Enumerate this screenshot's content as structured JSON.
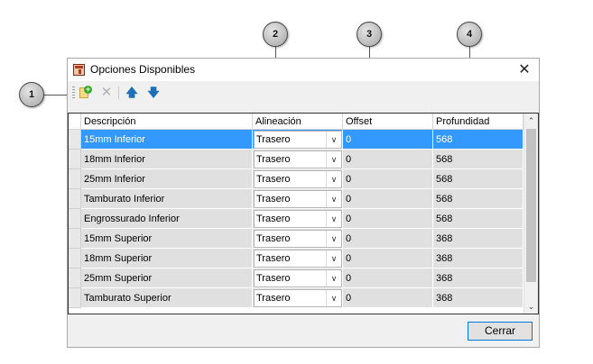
{
  "window": {
    "title": "Opciones Disponibles",
    "close_glyph": "✕"
  },
  "callouts": [
    "1",
    "2",
    "3",
    "4"
  ],
  "toolbar": {
    "icons": [
      "add-icon",
      "delete-icon",
      "move-up-icon",
      "move-down-icon"
    ],
    "up_glyph": "🡅",
    "down_glyph": "🡇",
    "delete_glyph": "✕",
    "add_glyph": "+"
  },
  "grid": {
    "columns": [
      "Descripción",
      "Alineación",
      "Offset",
      "Profundidad"
    ],
    "rows": [
      {
        "descripcion": "15mm Inferior",
        "alineacion": "Trasero",
        "offset": "0",
        "profundidad": "568"
      },
      {
        "descripcion": "18mm Inferior",
        "alineacion": "Trasero",
        "offset": "0",
        "profundidad": "568"
      },
      {
        "descripcion": "25mm Inferior",
        "alineacion": "Trasero",
        "offset": "0",
        "profundidad": "568"
      },
      {
        "descripcion": "Tamburato Inferior",
        "alineacion": "Trasero",
        "offset": "0",
        "profundidad": "568"
      },
      {
        "descripcion": "Engrossurado Inferior",
        "alineacion": "Trasero",
        "offset": "0",
        "profundidad": "568"
      },
      {
        "descripcion": "15mm Superior",
        "alineacion": "Trasero",
        "offset": "0",
        "profundidad": "368"
      },
      {
        "descripcion": "18mm Superior",
        "alineacion": "Trasero",
        "offset": "0",
        "profundidad": "368"
      },
      {
        "descripcion": "25mm Superior",
        "alineacion": "Trasero",
        "offset": "0",
        "profundidad": "368"
      },
      {
        "descripcion": "Tamburato Superior",
        "alineacion": "Trasero",
        "offset": "0",
        "profundidad": "368"
      }
    ],
    "selected_row": 0,
    "scroll_up": "⌃",
    "scroll_down": "⌄",
    "combo_arrow": "∨"
  },
  "footer": {
    "close_label": "Cerrar"
  },
  "colors": {
    "selection": "#3399ff",
    "accent": "#0078d7"
  }
}
